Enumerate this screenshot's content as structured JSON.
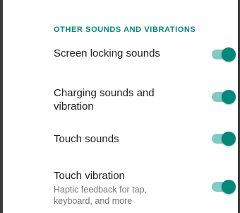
{
  "section": {
    "header": "OTHER SOUNDS AND VIBRATIONS"
  },
  "settings": [
    {
      "title": "Screen locking sounds",
      "summary": "",
      "enabled": true
    },
    {
      "title": "Charging sounds and vibration",
      "summary": "",
      "enabled": true
    },
    {
      "title": "Touch sounds",
      "summary": "",
      "enabled": true
    },
    {
      "title": "Touch vibration",
      "summary": "Haptic feedback for tap, keyboard, and more",
      "enabled": true
    }
  ],
  "colors": {
    "accent": "#00897b",
    "track_on": "#80cbc4",
    "title_text": "#212121",
    "summary_text": "#757575"
  }
}
